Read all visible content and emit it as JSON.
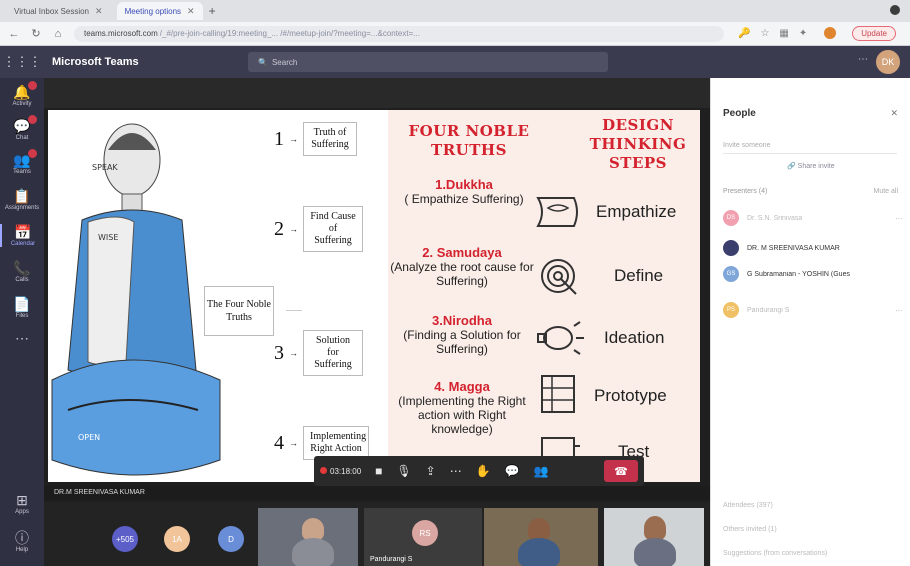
{
  "browser": {
    "tabs": [
      {
        "label": "Virtual Inbox Session",
        "active": false
      },
      {
        "label": "Meeting options",
        "active": true
      }
    ],
    "new_tab": "+",
    "url_host": "teams.microsoft.com",
    "url_rest": "/_#/pre-join-calling/19:meeting_... /#/meetup-join/?meeting=...&context=...",
    "update_label": "Update"
  },
  "teams": {
    "app_name": "Microsoft Teams",
    "search_placeholder": "Search",
    "avatar_initials": "DK"
  },
  "rail": [
    {
      "name": "activity",
      "label": "Activity",
      "icon": "🔔",
      "badge": true
    },
    {
      "name": "chat",
      "label": "Chat",
      "icon": "💬",
      "badge": true
    },
    {
      "name": "teams",
      "label": "Teams",
      "icon": "👥",
      "badge": true
    },
    {
      "name": "assignments",
      "label": "Assignments",
      "icon": "📋",
      "badge": false
    },
    {
      "name": "calendar",
      "label": "Calendar",
      "icon": "📅",
      "badge": false,
      "active": true
    },
    {
      "name": "calls",
      "label": "Calls",
      "icon": "📞",
      "badge": false
    },
    {
      "name": "files",
      "label": "Files",
      "icon": "📄",
      "badge": false
    },
    {
      "name": "more",
      "label": "",
      "icon": "⋯",
      "badge": false
    },
    {
      "name": "apps",
      "label": "Apps",
      "icon": "⊞",
      "badge": false
    },
    {
      "name": "help",
      "label": "Help",
      "icon": "ⓘ",
      "badge": false
    }
  ],
  "slide": {
    "steps": [
      {
        "num": "1",
        "text": "Truth of Suffering"
      },
      {
        "num": "2",
        "text": "Find Cause of Suffering"
      },
      {
        "num": "3",
        "text": "Solution for Suffering"
      },
      {
        "num": "4",
        "text": "Implementing Right Action"
      }
    ],
    "center_box": "The Four Noble Truths",
    "left_title": "FOUR NOBLE TRUTHS",
    "right_title": "DESIGN THINKING STEPS",
    "truths": [
      {
        "name": "1.Dukkha",
        "desc": "( Empathize Suffering)"
      },
      {
        "name": "2. Samudaya",
        "desc": "(Analyze the root cause for Suffering)"
      },
      {
        "name": "3.Nirodha",
        "desc": "(Finding a Solution for Suffering)"
      },
      {
        "name": "4. Magga",
        "desc": "(Implementing the Right action with Right knowledge)"
      }
    ],
    "dt_steps": [
      "Empathize",
      "Define",
      "Ideation",
      "Prototype",
      "Test"
    ]
  },
  "controls": {
    "timer": "03:18:00"
  },
  "presenter_name": "DR.M SREENIVASA KUMAR",
  "gallery": {
    "avatars": [
      {
        "initials": "+505",
        "color": "#5b5fc7"
      },
      {
        "initials": "1A",
        "color": "#f2c49a"
      },
      {
        "initials": "D",
        "color": "#6a8dd8"
      },
      {
        "initials": "RS",
        "color": "#d9a6a1"
      }
    ],
    "tile_names": [
      "",
      "Pandurangi S",
      "",
      ""
    ]
  },
  "people": {
    "title": "People",
    "invite_placeholder": "Invite someone",
    "share_invite": "Share invite",
    "presenters_label": "Presenters (4)",
    "mute_all": "Mute all",
    "participants": [
      {
        "initials": "DS",
        "name": "Dr. S.N. Srinivasa",
        "color": "#f1a0b0",
        "faded": true
      },
      {
        "initials": "",
        "name": "DR. M SREENIVASA KUMAR",
        "color": "#3b3f6e",
        "faded": false
      },
      {
        "initials": "GS",
        "name": "G Subramanian - YOSHIN (Gues",
        "color": "#7fa6d8",
        "faded": false
      },
      {
        "initials": "PS",
        "name": "Pandurangi S",
        "color": "#f0c066",
        "faded": true
      }
    ],
    "attendees_label": "Attendees (397)",
    "other_label": "Others invited (1)",
    "suggest_label": "Suggestions (from conversations)"
  }
}
